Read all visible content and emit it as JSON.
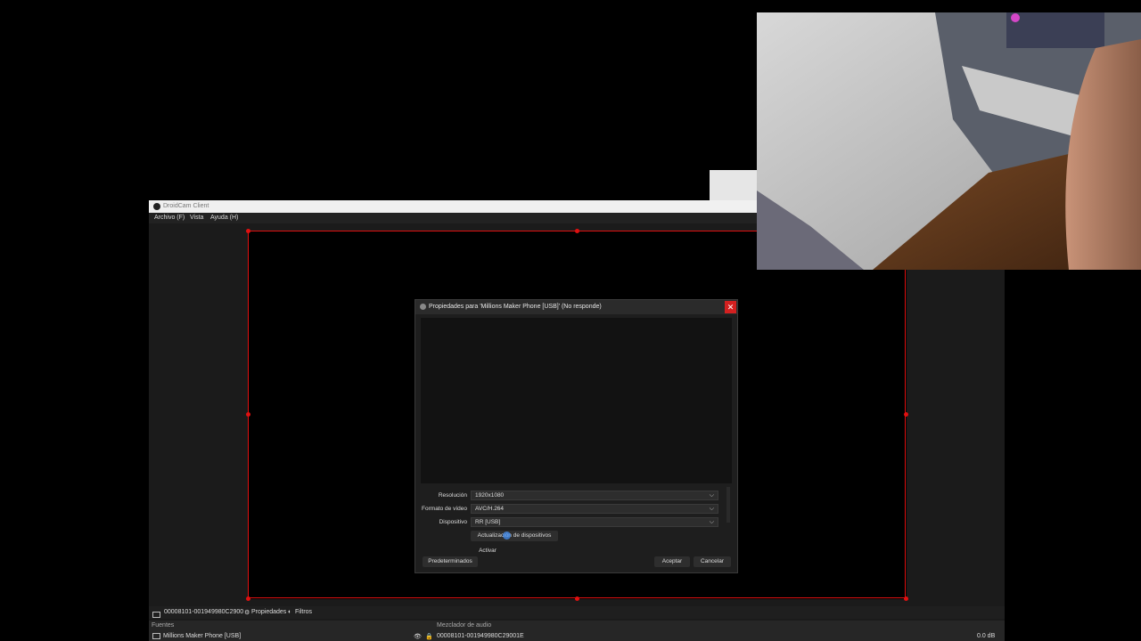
{
  "window": {
    "title": "DroidCam Client",
    "menu": [
      "Archivo (F)",
      "Vista",
      "Ayuda (H)"
    ]
  },
  "dialog": {
    "title": "Propiedades para 'Millions Maker Phone [USB]' (No responde)",
    "close_label": "✕",
    "fields": [
      {
        "label": "Resolución",
        "value": "1920x1080"
      },
      {
        "label": "Formato de vídeo",
        "value": "AVC/H.264"
      },
      {
        "label": "Dispositivo",
        "value": "RR [USB]"
      }
    ],
    "refresh_button": "Actualización de dispositivos",
    "activate_button": "Activar",
    "defaults_button": "Predeterminados",
    "ok_button": "Aceptar",
    "cancel_button": "Cancelar"
  },
  "source_toolbar": {
    "selected_source": "00008101-001949980C2900",
    "properties_label": "Propiedades",
    "filters_label": "Filtros"
  },
  "sources_dock": {
    "header": "Fuentes",
    "item": "Millions Maker Phone [USB]"
  },
  "mixer_dock": {
    "header": "Mezclador de audio",
    "channel": "00008101-001949980C29001E",
    "level": "0.0 dB"
  },
  "colors": {
    "selection_red": "#e01010",
    "close_red": "#d32020",
    "dialog_bg": "#1e1e1e"
  }
}
